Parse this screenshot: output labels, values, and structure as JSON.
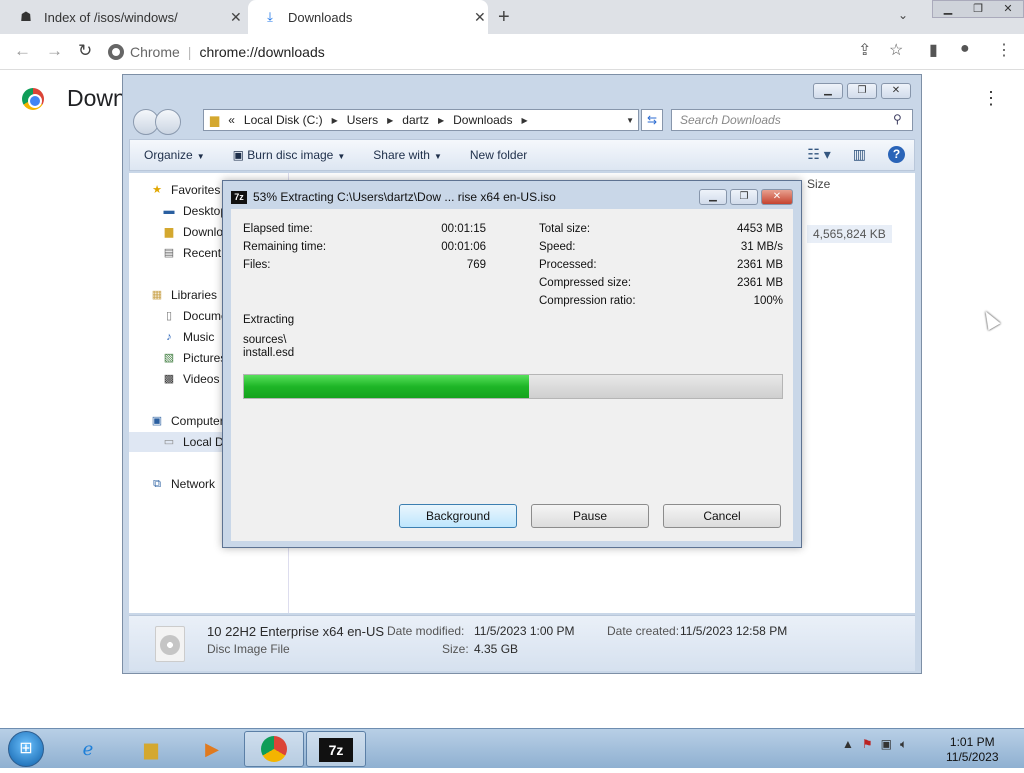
{
  "tabs": [
    {
      "title": "Index of /isos/windows/",
      "icon": "page-icon"
    },
    {
      "title": "Downloads",
      "icon": "download-icon"
    }
  ],
  "omnibox": {
    "site": "Chrome",
    "url": "chrome://downloads"
  },
  "page": {
    "title": "Down"
  },
  "explorer": {
    "breadcrumb": [
      "Local Disk (C:)",
      "Users",
      "dartz",
      "Downloads"
    ],
    "search_placeholder": "Search Downloads",
    "commands": [
      "Organize",
      "Burn disc image",
      "Share with",
      "New folder"
    ],
    "nav": [
      {
        "label": "Favorites",
        "icon": "star-icon"
      },
      {
        "label": "Desktop",
        "icon": "desktop-icon"
      },
      {
        "label": "Downloads",
        "icon": "folder-icon"
      },
      {
        "label": "Recent Places",
        "icon": "recent-icon"
      },
      {
        "label": "Libraries",
        "icon": "library-icon"
      },
      {
        "label": "Documents",
        "icon": "document-icon"
      },
      {
        "label": "Music",
        "icon": "music-icon"
      },
      {
        "label": "Pictures",
        "icon": "picture-icon"
      },
      {
        "label": "Videos",
        "icon": "video-icon"
      },
      {
        "label": "Computer",
        "icon": "computer-icon"
      },
      {
        "label": "Local Disk (C:)",
        "icon": "drive-icon"
      },
      {
        "label": "Network",
        "icon": "network-icon"
      }
    ],
    "size_header": "Size",
    "size_value": "4,565,824 KB",
    "details": {
      "filename": "10 22H2 Enterprise x64 en-US",
      "type": "Disc Image File",
      "modified_label": "Date modified:",
      "modified": "11/5/2023 1:00 PM",
      "created_label": "Date created:",
      "created": "11/5/2023 12:58 PM",
      "size_label": "Size:",
      "size": "4.35 GB"
    }
  },
  "zip": {
    "title": "53% Extracting C:\\Users\\dartz\\Dow ... rise x64 en-US.iso",
    "left": [
      {
        "label": "Elapsed time:",
        "value": "00:01:15"
      },
      {
        "label": "Remaining time:",
        "value": "00:01:06"
      },
      {
        "label": "Files:",
        "value": "769"
      }
    ],
    "right": [
      {
        "label": "Total size:",
        "value": "4453 MB"
      },
      {
        "label": "Speed:",
        "value": "31 MB/s"
      },
      {
        "label": "Processed:",
        "value": "2361 MB"
      },
      {
        "label": "Compressed size:",
        "value": "2361 MB"
      },
      {
        "label": "Compression ratio:",
        "value": "100%"
      }
    ],
    "status": "Extracting",
    "current_dir": "sources\\",
    "current_file": "install.esd",
    "progress": 0.53,
    "buttons": {
      "background": "Background",
      "pause": "Pause",
      "cancel": "Cancel"
    }
  },
  "taskbar": {
    "time": "1:01 PM",
    "date": "11/5/2023"
  }
}
